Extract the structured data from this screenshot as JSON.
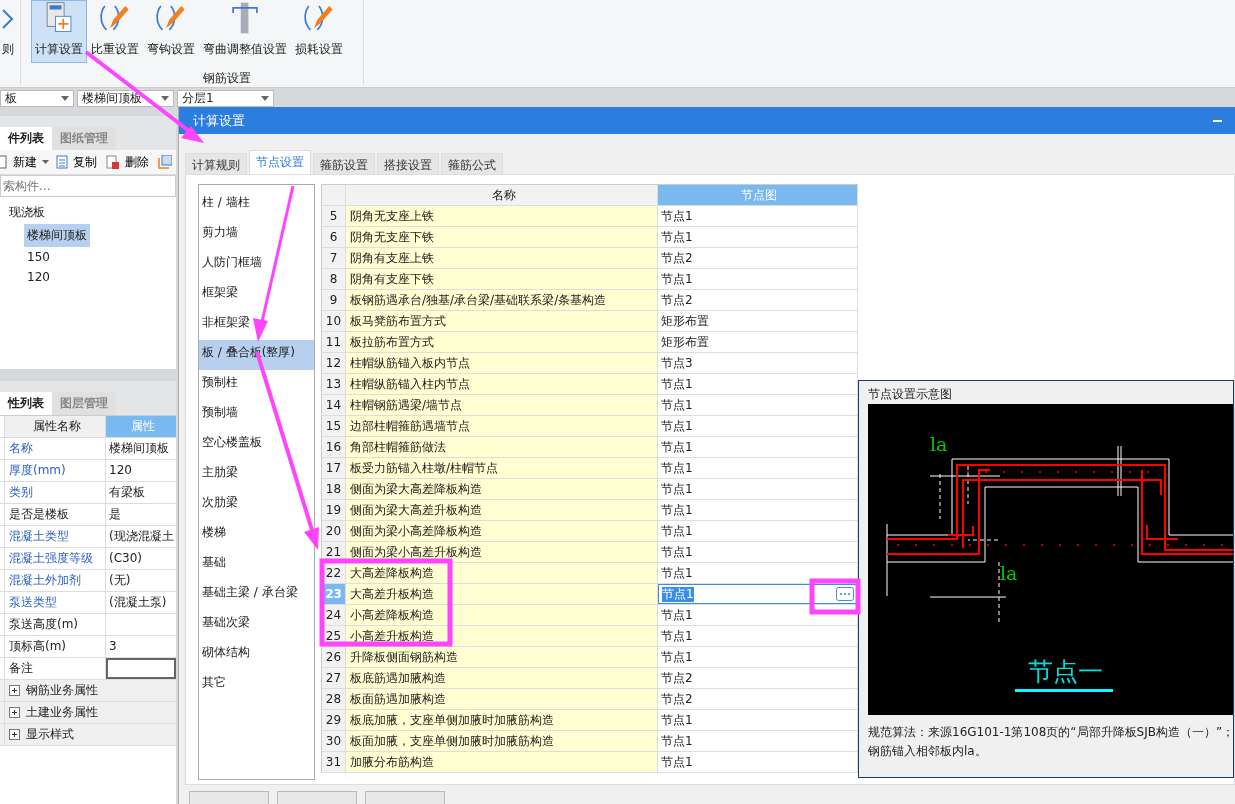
{
  "ribbon": {
    "items": [
      {
        "label": "则",
        "selected": false
      },
      {
        "label": "计算设置",
        "selected": true
      },
      {
        "label": "比重设置",
        "selected": false
      },
      {
        "label": "弯钩设置",
        "selected": false
      },
      {
        "label": "弯曲调整值设置",
        "selected": false
      },
      {
        "label": "损耗设置",
        "selected": false
      }
    ],
    "group_label": "钢筋设置"
  },
  "selectors": [
    "板",
    "楼梯间顶板",
    "分层1"
  ],
  "component_panel": {
    "tabs": [
      {
        "label": "件列表",
        "selected": true
      },
      {
        "label": "图纸管理",
        "selected": false
      }
    ],
    "toolbar": [
      "新建",
      "复制",
      "删除"
    ],
    "search": {
      "placeholder": "索构件..."
    },
    "tree": [
      {
        "label": "现浇板",
        "selected": false,
        "children": [
          {
            "label": "楼梯间顶板",
            "selected": true
          },
          {
            "label": "150",
            "selected": false
          },
          {
            "label": "120",
            "selected": false
          }
        ]
      }
    ]
  },
  "property_panel": {
    "tabs": [
      {
        "label": "性列表",
        "selected": true
      },
      {
        "label": "图层管理",
        "selected": false
      }
    ],
    "columns": [
      "属性名称",
      "属性"
    ],
    "rows": [
      {
        "name": "名称",
        "value": "楼梯间顶板",
        "public": true,
        "editing": false
      },
      {
        "name": "厚度(mm)",
        "value": "120",
        "public": true,
        "editing": false
      },
      {
        "name": "类别",
        "value": "有梁板",
        "public": true,
        "editing": false
      },
      {
        "name": "是否是楼板",
        "value": "是",
        "public": false,
        "editing": false
      },
      {
        "name": "混凝土类型",
        "value": "(现浇混凝土",
        "public": true,
        "editing": false
      },
      {
        "name": "混凝土强度等级",
        "value": "(C30)",
        "public": true,
        "editing": false
      },
      {
        "name": "混凝土外加剂",
        "value": "(无)",
        "public": true,
        "editing": false
      },
      {
        "name": "泵送类型",
        "value": "(混凝土泵)",
        "public": true,
        "editing": false
      },
      {
        "name": "泵送高度(m)",
        "public": false,
        "editing": false
      },
      {
        "name": "顶标高(m)",
        "value": "3",
        "public": false,
        "editing": false
      },
      {
        "name": "备注",
        "public": false,
        "editing": true
      }
    ],
    "groups": [
      {
        "label": "钢筋业务属性",
        "expanded": false
      },
      {
        "label": "土建业务属性",
        "expanded": false
      },
      {
        "label": "显示样式",
        "expanded": false
      }
    ]
  },
  "dialog": {
    "title": "计算设置",
    "tabs": [
      {
        "label": "计算规则",
        "selected": false
      },
      {
        "label": "节点设置",
        "selected": true
      },
      {
        "label": "箍筋设置",
        "selected": false
      },
      {
        "label": "搭接设置",
        "selected": false
      },
      {
        "label": "箍筋公式",
        "selected": false
      }
    ],
    "categories": [
      {
        "label": "柱 / 墙柱",
        "selected": false
      },
      {
        "label": "剪力墙",
        "selected": false
      },
      {
        "label": "人防门框墙",
        "selected": false
      },
      {
        "label": "框架梁",
        "selected": false
      },
      {
        "label": "非框架梁",
        "selected": false
      },
      {
        "label": "板 / 叠合板(整厚)",
        "selected": true
      },
      {
        "label": "预制柱",
        "selected": false
      },
      {
        "label": "预制墙",
        "selected": false
      },
      {
        "label": "空心楼盖板",
        "selected": false
      },
      {
        "label": "主肋梁",
        "selected": false
      },
      {
        "label": "次肋梁",
        "selected": false
      },
      {
        "label": "楼梯",
        "selected": false
      },
      {
        "label": "基础",
        "selected": false
      },
      {
        "label": "基础主梁 / 承台梁",
        "selected": false
      },
      {
        "label": "基础次梁",
        "selected": false
      },
      {
        "label": "砌体结构",
        "selected": false
      },
      {
        "label": "其它",
        "selected": false
      }
    ],
    "table": {
      "columns": [
        "名称",
        "节点图"
      ],
      "rows": [
        {
          "no": "5",
          "name": "阴角无支座上铁",
          "value": "节点1",
          "selected": false
        },
        {
          "no": "6",
          "name": "阴角无支座下铁",
          "value": "节点1",
          "selected": false
        },
        {
          "no": "7",
          "name": "阴角有支座上铁",
          "value": "节点2",
          "selected": false
        },
        {
          "no": "8",
          "name": "阴角有支座下铁",
          "value": "节点1",
          "selected": false
        },
        {
          "no": "9",
          "name": "板钢筋遇承台/独基/承台梁/基础联系梁/条基构造",
          "value": "节点2",
          "selected": false
        },
        {
          "no": "10",
          "name": "板马凳筋布置方式",
          "value": "矩形布置",
          "selected": false
        },
        {
          "no": "11",
          "name": "板拉筋布置方式",
          "value": "矩形布置",
          "selected": false
        },
        {
          "no": "12",
          "name": "柱帽纵筋锚入板内节点",
          "value": "节点3",
          "selected": false
        },
        {
          "no": "13",
          "name": "柱帽纵筋锚入柱内节点",
          "value": "节点1",
          "selected": false
        },
        {
          "no": "14",
          "name": "柱帽钢筋遇梁/墙节点",
          "value": "节点1",
          "selected": false
        },
        {
          "no": "15",
          "name": "边部柱帽箍筋遇墙节点",
          "value": "节点1",
          "selected": false
        },
        {
          "no": "16",
          "name": "角部柱帽箍筋做法",
          "value": "节点1",
          "selected": false
        },
        {
          "no": "17",
          "name": "板受力筋锚入柱墩/柱帽节点",
          "value": "节点1",
          "selected": false
        },
        {
          "no": "18",
          "name": "侧面为梁大高差降板构造",
          "value": "节点1",
          "selected": false
        },
        {
          "no": "19",
          "name": "侧面为梁大高差升板构造",
          "value": "节点1",
          "selected": false
        },
        {
          "no": "20",
          "name": "侧面为梁小高差降板构造",
          "value": "节点1",
          "selected": false
        },
        {
          "no": "21",
          "name": "侧面为梁小高差升板构造",
          "value": "节点1",
          "selected": false
        },
        {
          "no": "22",
          "name": "大高差降板构造",
          "value": "节点1",
          "selected": false
        },
        {
          "no": "23",
          "name": "大高差升板构造",
          "value": "节点1",
          "selected": true
        },
        {
          "no": "24",
          "name": "小高差降板构造",
          "value": "节点1",
          "selected": false
        },
        {
          "no": "25",
          "name": "小高差升板构造",
          "value": "节点1",
          "selected": false
        },
        {
          "no": "26",
          "name": "升降板侧面钢筋构造",
          "value": "节点1",
          "selected": false
        },
        {
          "no": "27",
          "name": "板底筋遇加腋构造",
          "value": "节点2",
          "selected": false
        },
        {
          "no": "28",
          "name": "板面筋遇加腋构造",
          "value": "节点2",
          "selected": false
        },
        {
          "no": "29",
          "name": "板底加腋，支座单侧加腋时加腋筋构造",
          "value": "节点1",
          "selected": false
        },
        {
          "no": "30",
          "name": "板面加腋，支座单侧加腋时加腋筋构造",
          "value": "节点1",
          "selected": false
        },
        {
          "no": "31",
          "name": "加腋分布筋构造",
          "value": "节点1",
          "selected": false
        }
      ]
    },
    "preview": {
      "title": "节点设置示意图",
      "labels": [
        "la",
        "la"
      ],
      "caption": "节点一",
      "note": [
        "规范算法：来源16G101-1第108页的“局部升降板SJB构造（一）”；",
        "钢筋锚入相邻板内la。"
      ]
    }
  }
}
